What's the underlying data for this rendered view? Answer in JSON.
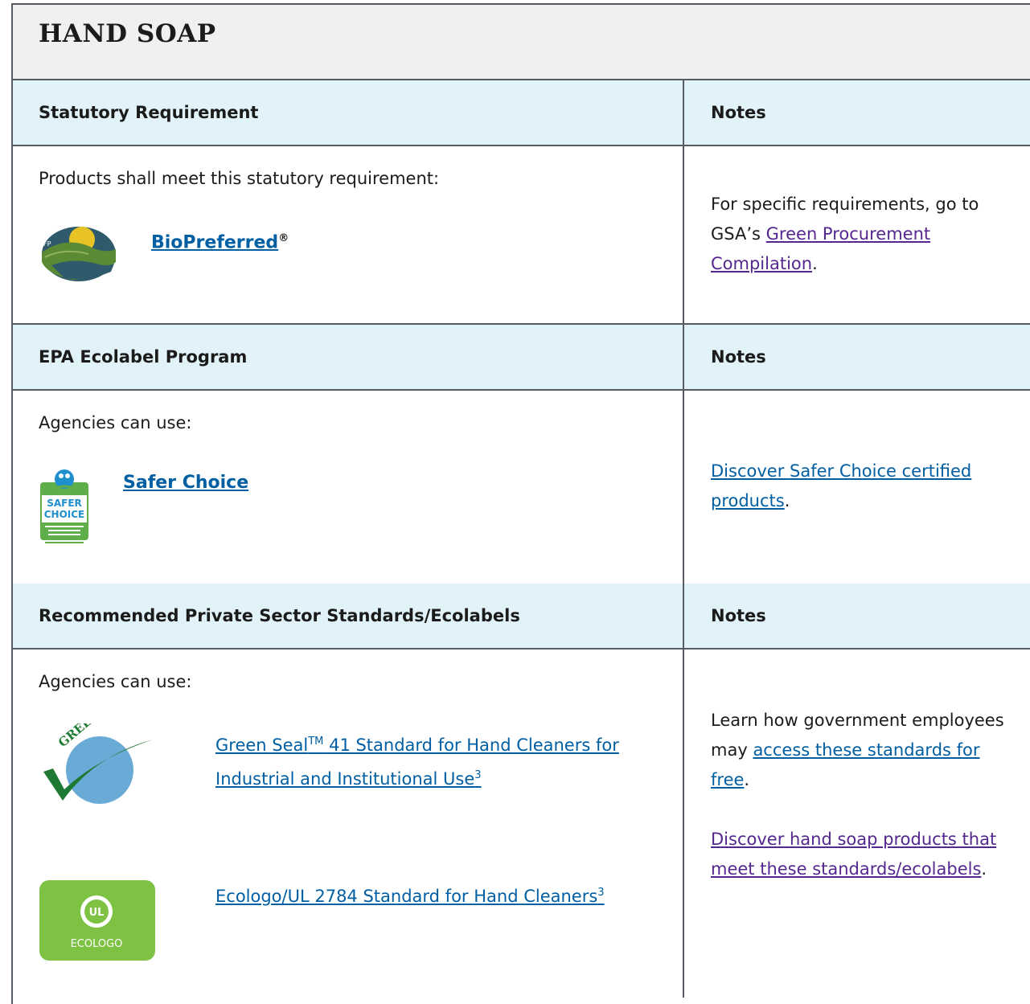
{
  "table_title": "HAND SOAP",
  "sections": [
    {
      "header_left": "Statutory Requirement",
      "header_right": "Notes",
      "intro": "Products shall meet this statutory requirement:",
      "items": [
        {
          "label": "BioPreferred",
          "sup": "®",
          "icon": "biopreferred-logo"
        }
      ],
      "notes": {
        "text_before": "For specific requirements, go to GSA’s ",
        "link": "Green Procurement Compilation",
        "text_after": "."
      }
    },
    {
      "header_left": "EPA Ecolabel Program",
      "header_right": "Notes",
      "intro": "Agencies can use:",
      "items": [
        {
          "label": "Safer Choice",
          "icon": "safer-choice-logo",
          "logo_text_1": "SAFER",
          "logo_text_2": "CHOICE"
        }
      ],
      "notes": {
        "link": "Discover Safer Choice certified products",
        "text_after": "."
      }
    },
    {
      "header_left": "Recommended Private Sector Standards/Ecolabels",
      "header_right": "Notes",
      "intro": "Agencies can use:",
      "items": [
        {
          "label_a": "Green Seal",
          "sup_a": "TM",
          "label_b": " 41 Standard for Hand Cleaners for Industrial and Institutional Use",
          "sup_b": "3",
          "icon": "green-seal-logo",
          "logo_text": "GREEN SEAL"
        },
        {
          "label_a": "Ecologo/UL 2784 Standard for Hand Cleaners",
          "sup_a": "3",
          "icon": "ecologo-logo",
          "logo_text_1": "UL",
          "logo_text_2": "ECOLOGO"
        }
      ],
      "notes": {
        "text_before": "Learn how government employees may ",
        "link": "access these standards for free",
        "text_after": ".",
        "link2": "Discover hand soap products that meet these standards/ecolabels",
        "text_after2": "."
      }
    }
  ],
  "colors": {
    "header_bg": "#e1f3f8",
    "title_bg": "#f0f0f0",
    "link": "#005ea2",
    "visited_link": "#54278f",
    "border": "#565c65"
  }
}
